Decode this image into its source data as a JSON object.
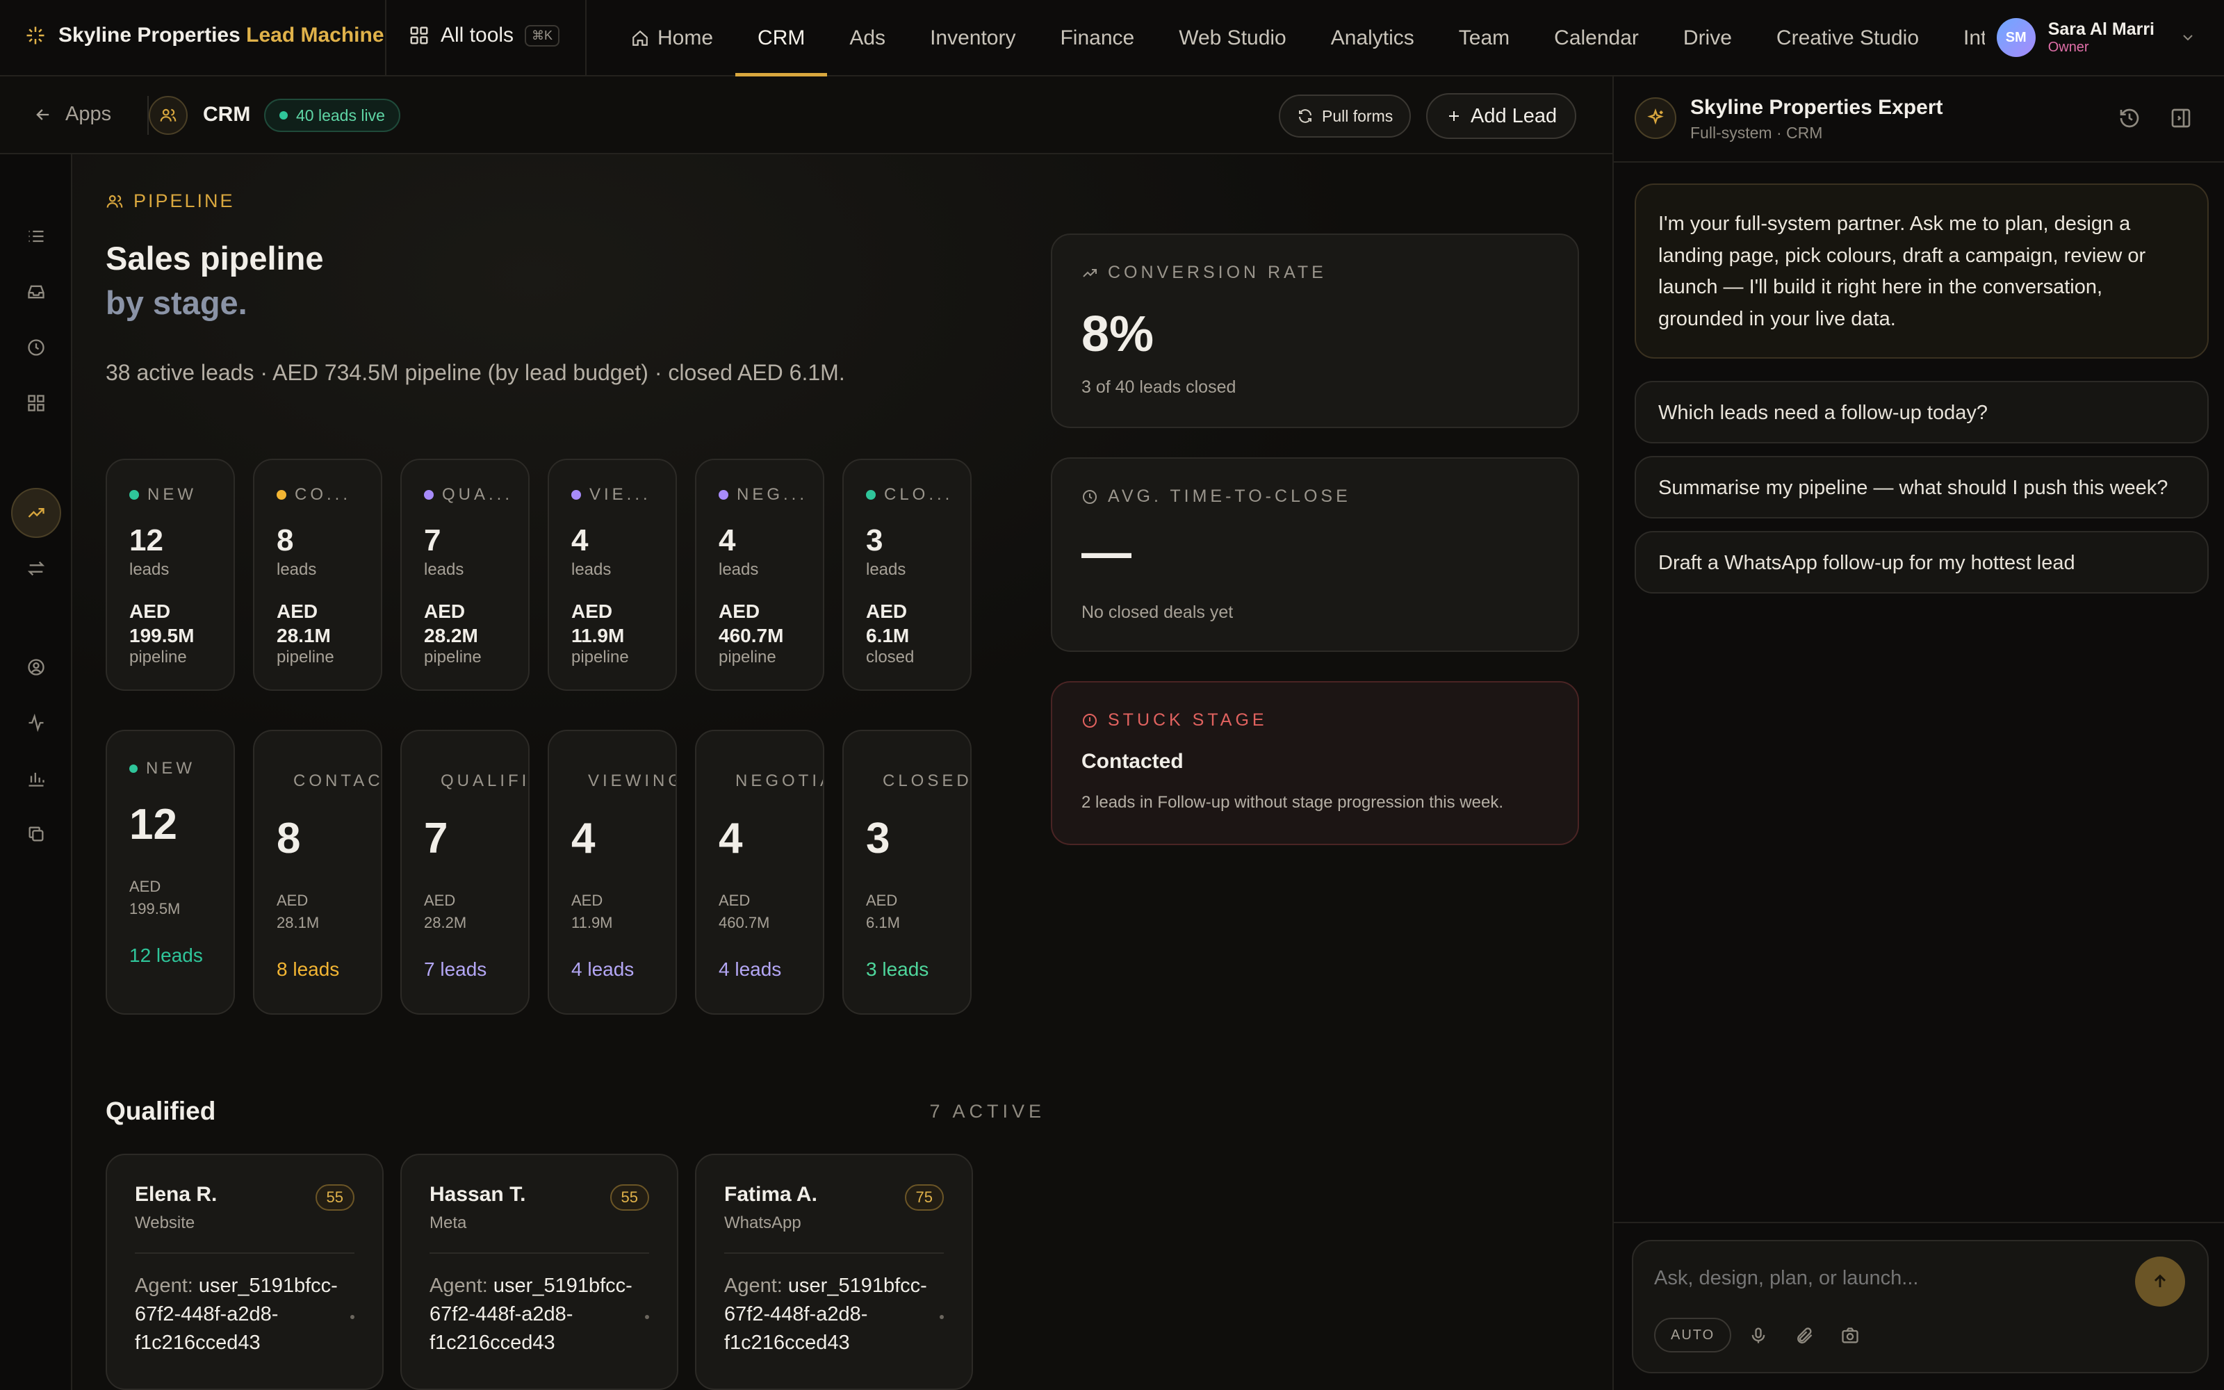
{
  "brand": {
    "name": "Skyline Properties",
    "accent": "Lead Machine"
  },
  "topbar": {
    "all_tools": "All tools",
    "shortcut": "⌘K",
    "nav": [
      {
        "label": "Home",
        "icon": "home-icon"
      },
      {
        "label": "CRM"
      },
      {
        "label": "Ads"
      },
      {
        "label": "Inventory"
      },
      {
        "label": "Finance"
      },
      {
        "label": "Web Studio"
      },
      {
        "label": "Analytics"
      },
      {
        "label": "Team"
      },
      {
        "label": "Calendar"
      },
      {
        "label": "Drive"
      },
      {
        "label": "Creative Studio"
      },
      {
        "label": "Integ"
      }
    ],
    "active_nav": "CRM",
    "user": {
      "initials": "SM",
      "name": "Sara Al Marri",
      "role": "Owner"
    }
  },
  "subheader": {
    "back": "Apps",
    "section": "CRM",
    "live_badge": "40 leads live",
    "pull_forms": "Pull forms",
    "add_lead": "Add Lead"
  },
  "pipeline": {
    "eyebrow": "PIPELINE",
    "title": "Sales pipeline",
    "title_sub": "by stage.",
    "summary": "38 active leads · AED 734.5M pipeline (by lead budget) · closed AED 6.1M.",
    "stages": [
      {
        "label": "NEW",
        "count": "12",
        "unit": "leads",
        "aed_label": "AED",
        "amount": "199.5M",
        "sub": "pipeline",
        "color": "#2fc59a"
      },
      {
        "label": "CO...",
        "count": "8",
        "unit": "leads",
        "aed_label": "AED",
        "amount": "28.1M",
        "sub": "pipeline",
        "color": "#f2b533"
      },
      {
        "label": "QUA...",
        "count": "7",
        "unit": "leads",
        "aed_label": "AED",
        "amount": "28.2M",
        "sub": "pipeline",
        "color": "#a78bfa"
      },
      {
        "label": "VIE...",
        "count": "4",
        "unit": "leads",
        "aed_label": "AED",
        "amount": "11.9M",
        "sub": "pipeline",
        "color": "#a78bfa"
      },
      {
        "label": "NEG...",
        "count": "4",
        "unit": "leads",
        "aed_label": "AED",
        "amount": "460.7M",
        "sub": "pipeline",
        "color": "#a78bfa"
      },
      {
        "label": "CLO...",
        "count": "3",
        "unit": "leads",
        "aed_label": "AED",
        "amount": "6.1M",
        "sub": "closed",
        "color": "#2fc59a"
      }
    ],
    "stage_columns": [
      {
        "label": "NEW",
        "count": "12",
        "aed": "AED",
        "amount": "199.5M",
        "leads": "12 leads",
        "color": "#2fc59a",
        "dot": true
      },
      {
        "label": "CONTACTED",
        "count": "8",
        "aed": "AED",
        "amount": "28.1M",
        "leads": "8 leads",
        "color": "#f2b533",
        "dot": false
      },
      {
        "label": "QUALIFIED",
        "count": "7",
        "aed": "AED",
        "amount": "28.2M",
        "leads": "7 leads",
        "color": "#b4a7f5",
        "dot": false
      },
      {
        "label": "VIEWING",
        "count": "4",
        "aed": "AED",
        "amount": "11.9M",
        "leads": "4 leads",
        "color": "#b4a7f5",
        "dot": false
      },
      {
        "label": "NEGOTIATION",
        "count": "4",
        "aed": "AED",
        "amount": "460.7M",
        "leads": "4 leads",
        "color": "#b4a7f5",
        "dot": false
      },
      {
        "label": "CLOSED",
        "count": "3",
        "aed": "AED",
        "amount": "6.1M",
        "leads": "3 leads",
        "color": "#4fd69c",
        "dot": false
      }
    ]
  },
  "metrics": {
    "conversion": {
      "label": "CONVERSION RATE",
      "value": "8%",
      "sub": "3 of 40 leads closed"
    },
    "time_to_close": {
      "label": "AVG. TIME-TO-CLOSE",
      "value": "—",
      "sub": "No closed deals yet"
    },
    "stuck": {
      "label": "STUCK STAGE",
      "stage": "Contacted",
      "sub": "2 leads in Follow-up without stage progression this week."
    }
  },
  "qualified": {
    "title": "Qualified",
    "count": "7 ACTIVE",
    "agent_label": "Agent:",
    "leads": [
      {
        "name": "Elena R.",
        "source": "Website",
        "score": "55",
        "agent": "user_5191bfcc-67f2-448f-a2d8-f1c216cced43"
      },
      {
        "name": "Hassan T.",
        "source": "Meta",
        "score": "55",
        "agent": "user_5191bfcc-67f2-448f-a2d8-f1c216cced43"
      },
      {
        "name": "Fatima A.",
        "source": "WhatsApp",
        "score": "75",
        "agent": "user_5191bfcc-67f2-448f-a2d8-f1c216cced43"
      }
    ]
  },
  "assistant": {
    "title": "Skyline Properties Expert",
    "subtitle": "Full-system · CRM",
    "intro": "I'm your full-system partner. Ask me to plan, design a landing page, pick colours, draft a campaign, review or launch — I'll build it right here in the conversation, grounded in your live data.",
    "suggestions": [
      "Which leads need a follow-up today?",
      "Summarise my pipeline — what should I push this week?",
      "Draft a WhatsApp follow-up for my hottest lead"
    ],
    "input_placeholder": "Ask, design, plan, or launch...",
    "mode": "AUTO"
  },
  "colors": {
    "accent": "#d9a73e",
    "danger": "#e0625f",
    "success": "#2fc59a",
    "purple": "#a78bfa"
  }
}
